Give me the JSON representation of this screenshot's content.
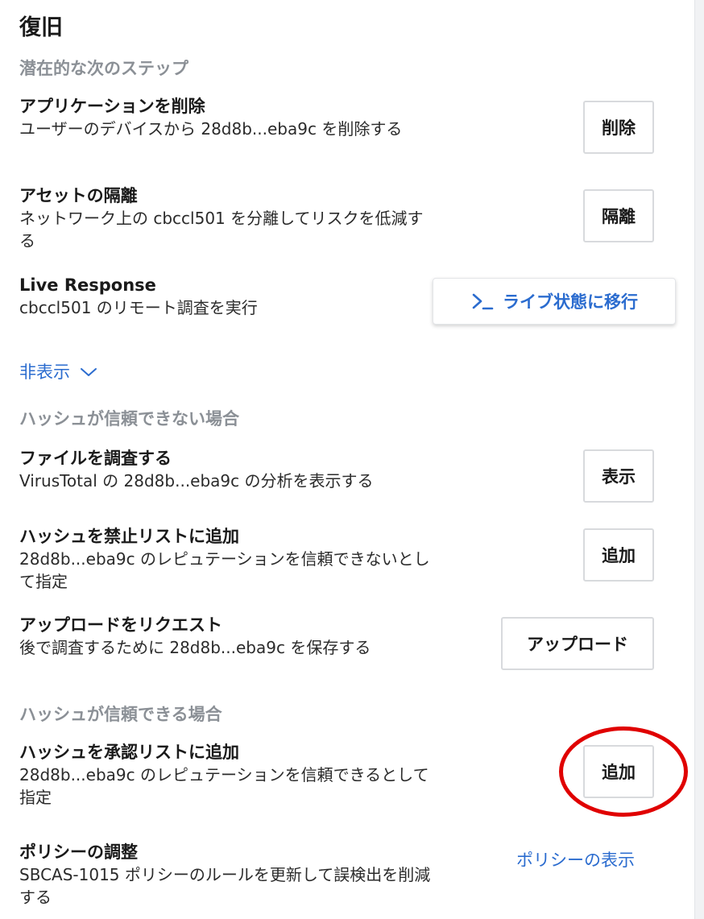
{
  "title": "復旧",
  "sections": {
    "next_steps": "潜在的な次のステップ",
    "untrusted": "ハッシュが信頼できない場合",
    "trusted": "ハッシュが信頼できる場合"
  },
  "items": {
    "delete_app": {
      "title": "アプリケーションを削除",
      "desc": "ユーザーのデバイスから 28d8b...eba9c を削除する",
      "button": "削除"
    },
    "isolate": {
      "title": "アセットの隔離",
      "desc": "ネットワーク上の cbccl501 を分離してリスクを低減する",
      "button": "隔離"
    },
    "live_response": {
      "title": "Live Response",
      "desc": "cbccl501 のリモート調査を実行",
      "button": "ライブ状態に移行"
    },
    "investigate_file": {
      "title": "ファイルを調査する",
      "desc": "VirusTotal の 28d8b...eba9c の分析を表示する",
      "button": "表示"
    },
    "ban_hash": {
      "title": "ハッシュを禁止リストに追加",
      "desc": "28d8b...eba9c のレピュテーションを信頼できないとして指定",
      "button": "追加"
    },
    "request_upload": {
      "title": "アップロードをリクエスト",
      "desc": "後で調査するために 28d8b...eba9c を保存する",
      "button": "アップロード"
    },
    "approve_hash": {
      "title": "ハッシュを承認リストに追加",
      "desc": "28d8b...eba9c のレピュテーションを信頼できるとして指定",
      "button": "追加"
    },
    "policy": {
      "title": "ポリシーの調整",
      "desc": "SBCAS-1015 ポリシーのルールを更新して誤検出を削減する",
      "link": "ポリシーの表示"
    }
  },
  "toggle": {
    "label": "非表示"
  },
  "colors": {
    "link": "#2b6ccf",
    "muted_heading": "#8b9096",
    "annotation": "#e00000"
  },
  "icons": {
    "terminal": "terminal-icon",
    "chevron": "chevron-down-icon"
  }
}
